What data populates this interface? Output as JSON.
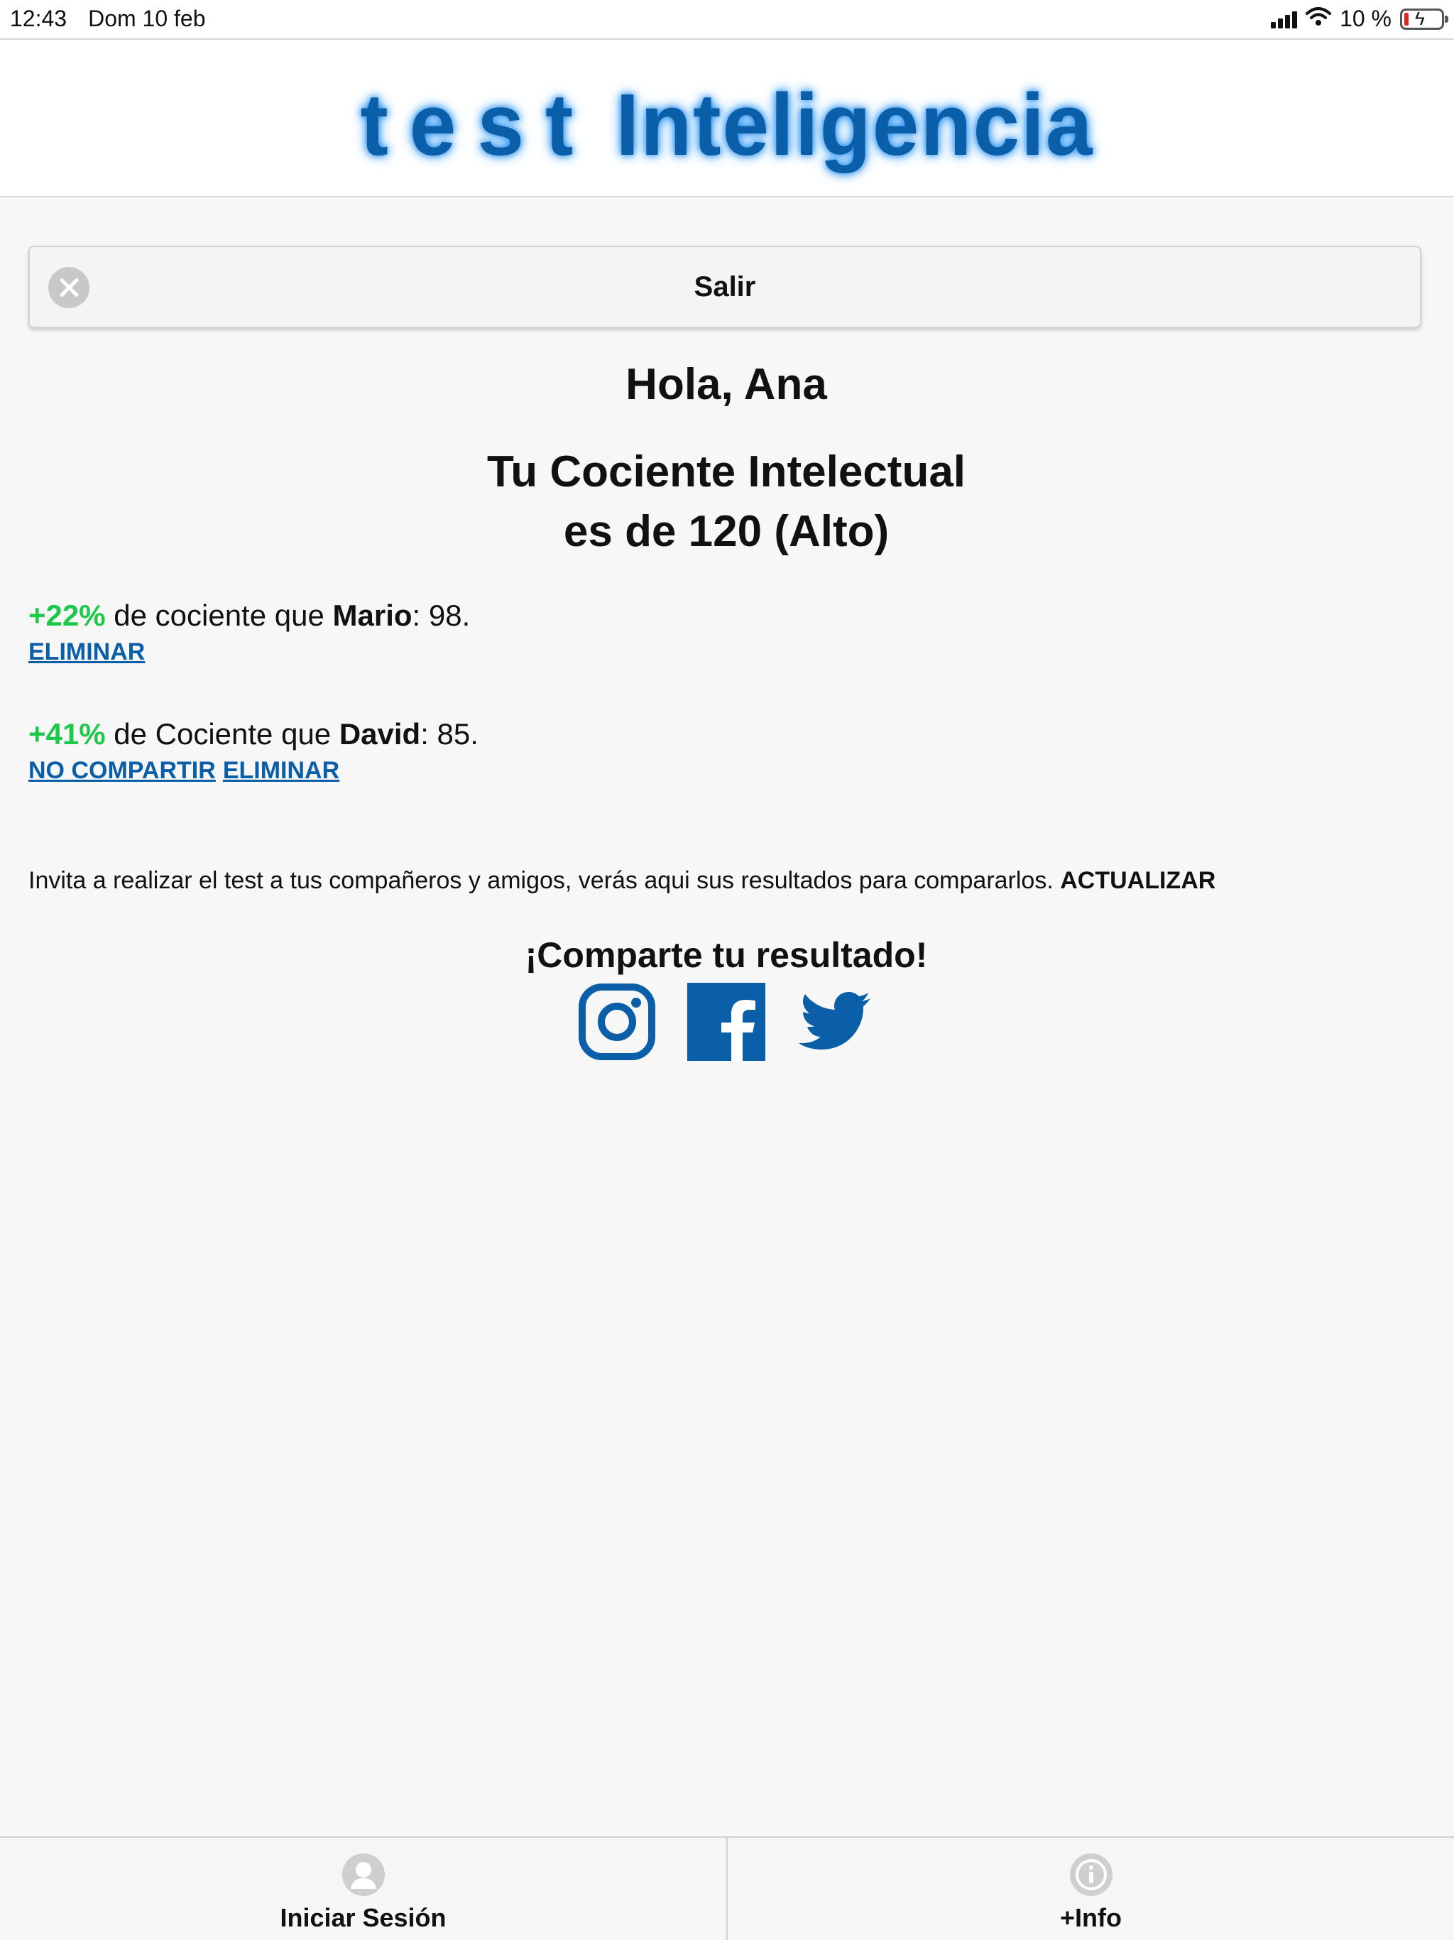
{
  "status_bar": {
    "time": "12:43",
    "date": "Dom 10 feb",
    "battery": "10 %",
    "icons": [
      "signal-icon",
      "wifi-icon",
      "battery-charging-icon"
    ]
  },
  "header": {
    "logo_word1": "test",
    "logo_word2": "Inteligencia"
  },
  "salir_button": {
    "label": "Salir",
    "icon": "close-circle-icon"
  },
  "greeting": "Hola, Ana",
  "iq": {
    "line1": "Tu Cociente Intelectual",
    "line2": "es de 120 (Alto)"
  },
  "comparisons": [
    {
      "pct": "+22%",
      "text": " de cociente que ",
      "name": "Mario",
      "score": ": 98.",
      "links": [
        "ELIMINAR"
      ]
    },
    {
      "pct": "+41%",
      "text": " de Cociente que ",
      "name": "David",
      "score": ": 85.",
      "links": [
        "NO COMPARTIR",
        "ELIMINAR"
      ]
    }
  ],
  "invite": {
    "text": "Invita a realizar el test a tus compañeros y amigos, verás aqui sus resultados para compararlos. ",
    "action": "ACTUALIZAR"
  },
  "share": {
    "title": "¡Comparte tu resultado!",
    "icons": [
      "instagram-icon",
      "facebook-icon",
      "twitter-icon"
    ],
    "brand_color": "#0a5fa8"
  },
  "bottom_tabs": [
    {
      "label": "Iniciar Sesión",
      "icon": "user-icon"
    },
    {
      "label": "+Info",
      "icon": "info-icon"
    }
  ],
  "colors": {
    "positive": "#1ec94a",
    "link": "#0b5ea8",
    "battery_low": "#e02424"
  }
}
